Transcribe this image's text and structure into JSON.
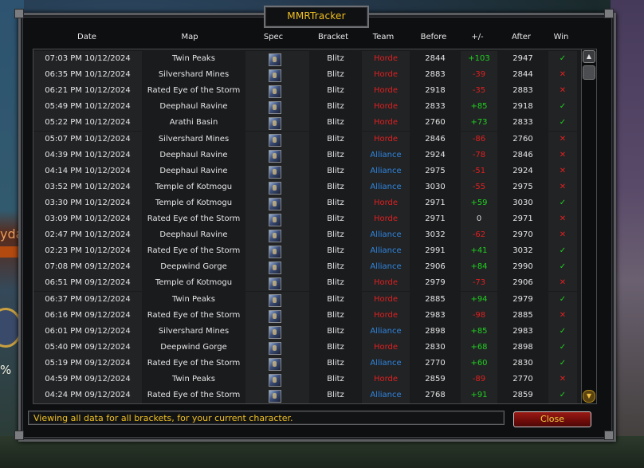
{
  "window": {
    "title": "MMRTracker"
  },
  "columns": [
    "Date",
    "Map",
    "Spec",
    "Bracket",
    "Team",
    "Before",
    "+/-",
    "After",
    "Win"
  ],
  "colors": {
    "horde": "#e02020",
    "alliance": "#2e86e0",
    "positive": "#20d020",
    "negative": "#e02020",
    "neutral": "#d8d8d8",
    "title_gold": "#f0c020"
  },
  "icons": {
    "spec": "shaman-spec-icon",
    "win": "check-icon",
    "loss": "x-icon"
  },
  "rows": [
    {
      "date": "07:03 PM 10/12/2024",
      "map": "Twin Peaks",
      "bracket": "Blitz",
      "team": "Horde",
      "before": "2844",
      "change": "+103",
      "after": "2947",
      "win": "✓"
    },
    {
      "date": "06:35 PM 10/12/2024",
      "map": "Silvershard Mines",
      "bracket": "Blitz",
      "team": "Horde",
      "before": "2883",
      "change": "-39",
      "after": "2844",
      "win": "✕"
    },
    {
      "date": "06:21 PM 10/12/2024",
      "map": "Rated Eye of the Storm",
      "bracket": "Blitz",
      "team": "Horde",
      "before": "2918",
      "change": "-35",
      "after": "2883",
      "win": "✕"
    },
    {
      "date": "05:49 PM 10/12/2024",
      "map": "Deephaul Ravine",
      "bracket": "Blitz",
      "team": "Horde",
      "before": "2833",
      "change": "+85",
      "after": "2918",
      "win": "✓"
    },
    {
      "date": "05:22 PM 10/12/2024",
      "map": "Arathi Basin",
      "bracket": "Blitz",
      "team": "Horde",
      "before": "2760",
      "change": "+73",
      "after": "2833",
      "win": "✓"
    },
    {
      "date": "05:07 PM 10/12/2024",
      "map": "Silvershard Mines",
      "bracket": "Blitz",
      "team": "Horde",
      "before": "2846",
      "change": "-86",
      "after": "2760",
      "win": "✕"
    },
    {
      "date": "04:39 PM 10/12/2024",
      "map": "Deephaul Ravine",
      "bracket": "Blitz",
      "team": "Alliance",
      "before": "2924",
      "change": "-78",
      "after": "2846",
      "win": "✕"
    },
    {
      "date": "04:14 PM 10/12/2024",
      "map": "Deephaul Ravine",
      "bracket": "Blitz",
      "team": "Alliance",
      "before": "2975",
      "change": "-51",
      "after": "2924",
      "win": "✕"
    },
    {
      "date": "03:52 PM 10/12/2024",
      "map": "Temple of Kotmogu",
      "bracket": "Blitz",
      "team": "Alliance",
      "before": "3030",
      "change": "-55",
      "after": "2975",
      "win": "✕"
    },
    {
      "date": "03:30 PM 10/12/2024",
      "map": "Temple of Kotmogu",
      "bracket": "Blitz",
      "team": "Horde",
      "before": "2971",
      "change": "+59",
      "after": "3030",
      "win": "✓"
    },
    {
      "date": "03:09 PM 10/12/2024",
      "map": "Rated Eye of the Storm",
      "bracket": "Blitz",
      "team": "Horde",
      "before": "2971",
      "change": "0",
      "after": "2971",
      "win": "✕"
    },
    {
      "date": "02:47 PM 10/12/2024",
      "map": "Deephaul Ravine",
      "bracket": "Blitz",
      "team": "Alliance",
      "before": "3032",
      "change": "-62",
      "after": "2970",
      "win": "✕"
    },
    {
      "date": "02:23 PM 10/12/2024",
      "map": "Rated Eye of the Storm",
      "bracket": "Blitz",
      "team": "Alliance",
      "before": "2991",
      "change": "+41",
      "after": "3032",
      "win": "✓"
    },
    {
      "date": "07:08 PM 09/12/2024",
      "map": "Deepwind Gorge",
      "bracket": "Blitz",
      "team": "Alliance",
      "before": "2906",
      "change": "+84",
      "after": "2990",
      "win": "✓"
    },
    {
      "date": "06:51 PM 09/12/2024",
      "map": "Temple of Kotmogu",
      "bracket": "Blitz",
      "team": "Horde",
      "before": "2979",
      "change": "-73",
      "after": "2906",
      "win": "✕"
    },
    {
      "date": "06:37 PM 09/12/2024",
      "map": "Twin Peaks",
      "bracket": "Blitz",
      "team": "Horde",
      "before": "2885",
      "change": "+94",
      "after": "2979",
      "win": "✓"
    },
    {
      "date": "06:16 PM 09/12/2024",
      "map": "Rated Eye of the Storm",
      "bracket": "Blitz",
      "team": "Horde",
      "before": "2983",
      "change": "-98",
      "after": "2885",
      "win": "✕"
    },
    {
      "date": "06:01 PM 09/12/2024",
      "map": "Silvershard Mines",
      "bracket": "Blitz",
      "team": "Alliance",
      "before": "2898",
      "change": "+85",
      "after": "2983",
      "win": "✓"
    },
    {
      "date": "05:40 PM 09/12/2024",
      "map": "Deepwind Gorge",
      "bracket": "Blitz",
      "team": "Horde",
      "before": "2830",
      "change": "+68",
      "after": "2898",
      "win": "✓"
    },
    {
      "date": "05:19 PM 09/12/2024",
      "map": "Rated Eye of the Storm",
      "bracket": "Blitz",
      "team": "Alliance",
      "before": "2770",
      "change": "+60",
      "after": "2830",
      "win": "✓"
    },
    {
      "date": "04:59 PM 09/12/2024",
      "map": "Twin Peaks",
      "bracket": "Blitz",
      "team": "Horde",
      "before": "2859",
      "change": "-89",
      "after": "2770",
      "win": "✕"
    },
    {
      "date": "04:24 PM 09/12/2024",
      "map": "Rated Eye of the Storm",
      "bracket": "Blitz",
      "team": "Alliance",
      "before": "2768",
      "change": "+91",
      "after": "2859",
      "win": "✓"
    }
  ],
  "status_text": "Viewing all data for all brackets, for your current character.",
  "close_label": "Close",
  "background": {
    "left_text": "yda",
    "left_pct": "%"
  }
}
